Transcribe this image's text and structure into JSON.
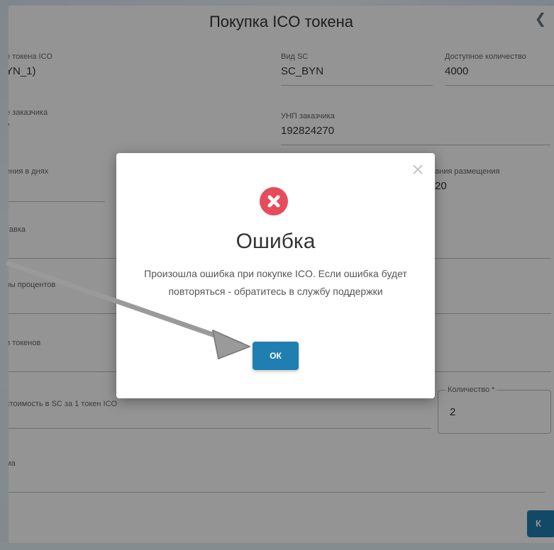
{
  "page": {
    "title": "Покупка ICO токена",
    "fields": {
      "token_name": {
        "label": "е токена ICO",
        "value": "YN_1)"
      },
      "sc_type": {
        "label": "Вид SC",
        "value": "SC_BYN"
      },
      "available_qty": {
        "label": "Доступное количество",
        "value": "4000"
      },
      "customer_name": {
        "label": "е заказчика",
        "value": "\""
      },
      "customer_unp": {
        "label": "УНП заказчика",
        "value": "192824270"
      },
      "term_days": {
        "label": "ения в днях",
        "value": ""
      },
      "placement": {
        "label": "ания размещения",
        "value": "20"
      },
      "rate": {
        "label": "тавка",
        "value": ""
      },
      "interest": {
        "label": "вы  процентов",
        "value": ")"
      },
      "tokens": {
        "label": "и токенов",
        "value": ")"
      },
      "price": {
        "label": "стоимость в SC за 1 токен ICO",
        "value": ""
      },
      "sum": {
        "label": "ма",
        "value": ""
      }
    },
    "quantity": {
      "label": "Количество *",
      "value": "2"
    },
    "submit_label": "К"
  },
  "modal": {
    "title": "Ошибка",
    "message": "Произошла ошибка при покупке ICO. Если ошибка будет повторяться - обратитесь в службу поддержки",
    "ok_label": "ОК",
    "close_symbol": "×"
  },
  "icons": {
    "error": "error-circle-x-icon",
    "close": "close-icon",
    "annotation": "pointer-arrow"
  },
  "colors": {
    "accent": "#1f7fb0",
    "error": "#e74c5c",
    "overlay": "rgba(0,0,0,0.42)",
    "arrow": "#9a9a9a"
  }
}
